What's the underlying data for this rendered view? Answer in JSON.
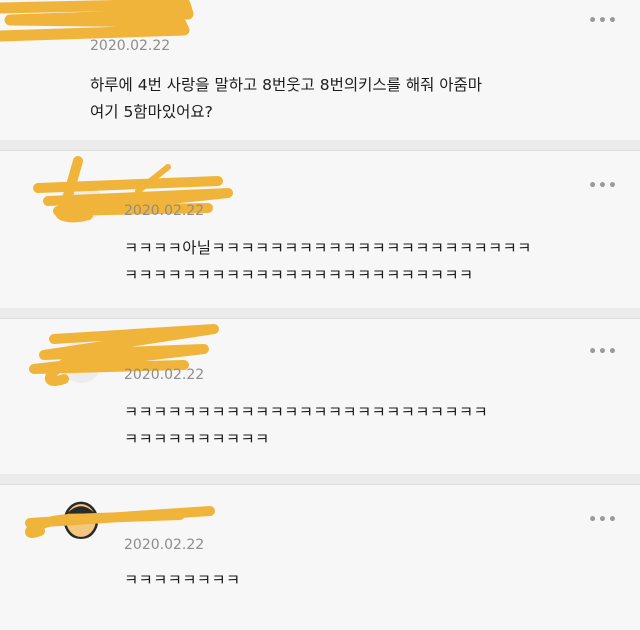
{
  "colors": {
    "scribble": "#f0b43a",
    "text": "#1c1c1c",
    "date": "#8d8d8d"
  },
  "comments": [
    {
      "date": "2020.02.22",
      "text": "하루에 4번 사랑을 말하고 8번웃고 8번의키스를 해줘 아줌마\n여기 5함마있어요?",
      "more": "•••"
    },
    {
      "date": "2020.02.22",
      "text": "ㅋㅋㅋㅋ아닐ㅋㅋㅋㅋㅋㅋㅋㅋㅋㅋㅋㅋㅋㅋㅋㅋㅋㅋㅋㅋㅋㅋ\nㅋㅋㅋㅋㅋㅋㅋㅋㅋㅋㅋㅋㅋㅋㅋㅋㅋㅋㅋㅋㅋㅋㅋㅋ",
      "more": "•••"
    },
    {
      "date": "2020.02.22",
      "text": "ㅋㅋㅋㅋㅋㅋㅋㅋㅋㅋㅋㅋㅋㅋㅋㅋㅋㅋㅋㅋㅋㅋㅋㅋㅋ\nㅋㅋㅋㅋㅋㅋㅋㅋㅋㅋ",
      "more": "•••"
    },
    {
      "date": "2020.02.22",
      "text": "ㅋㅋㅋㅋㅋㅋㅋㅋ",
      "more": "•••"
    }
  ]
}
